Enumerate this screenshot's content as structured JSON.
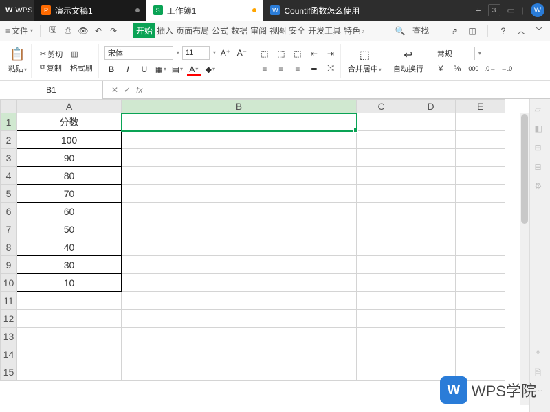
{
  "app": {
    "name": "WPS",
    "logo_letter": "W"
  },
  "tabs": [
    {
      "icon": "P",
      "label": "演示文稿1",
      "color": "o"
    },
    {
      "icon": "S",
      "label": "工作簿1",
      "color": "g",
      "active": true
    },
    {
      "icon": "W",
      "label": "Countif函数怎么使用",
      "color": "b"
    }
  ],
  "titlebar": {
    "new_tab": "+",
    "tab_count": "3",
    "avatar_letter": "W"
  },
  "menubar": {
    "file_label": "文件",
    "tabs": [
      "开始",
      "插入",
      "页面布局",
      "公式",
      "数据",
      "审阅",
      "视图",
      "安全",
      "开发工具",
      "特色"
    ],
    "active_index": 0,
    "search_label": "查找"
  },
  "ribbon": {
    "paste": "粘贴",
    "cut": "剪切",
    "copy": "复制",
    "fmt_painter": "格式刷",
    "font_name": "宋体",
    "font_size": "11",
    "merge": "合并居中",
    "wrap": "自动换行",
    "num_fmt": "常规"
  },
  "formula_bar": {
    "cell_ref": "B1",
    "fx": "fx",
    "formula": ""
  },
  "columns": [
    "A",
    "B",
    "C",
    "D",
    "E"
  ],
  "active_col_index": 1,
  "active_row_index": 0,
  "rows": [
    {
      "n": 1,
      "A": "分数"
    },
    {
      "n": 2,
      "A": "100"
    },
    {
      "n": 3,
      "A": "90"
    },
    {
      "n": 4,
      "A": "80"
    },
    {
      "n": 5,
      "A": "70"
    },
    {
      "n": 6,
      "A": "60"
    },
    {
      "n": 7,
      "A": "50"
    },
    {
      "n": 8,
      "A": "40"
    },
    {
      "n": 9,
      "A": "30"
    },
    {
      "n": 10,
      "A": "10"
    },
    {
      "n": 11,
      "A": ""
    },
    {
      "n": 12,
      "A": ""
    },
    {
      "n": 13,
      "A": ""
    },
    {
      "n": 14,
      "A": ""
    },
    {
      "n": 15,
      "A": ""
    }
  ],
  "watermark": {
    "text": "WPS学院",
    "logo_letter": "W"
  }
}
